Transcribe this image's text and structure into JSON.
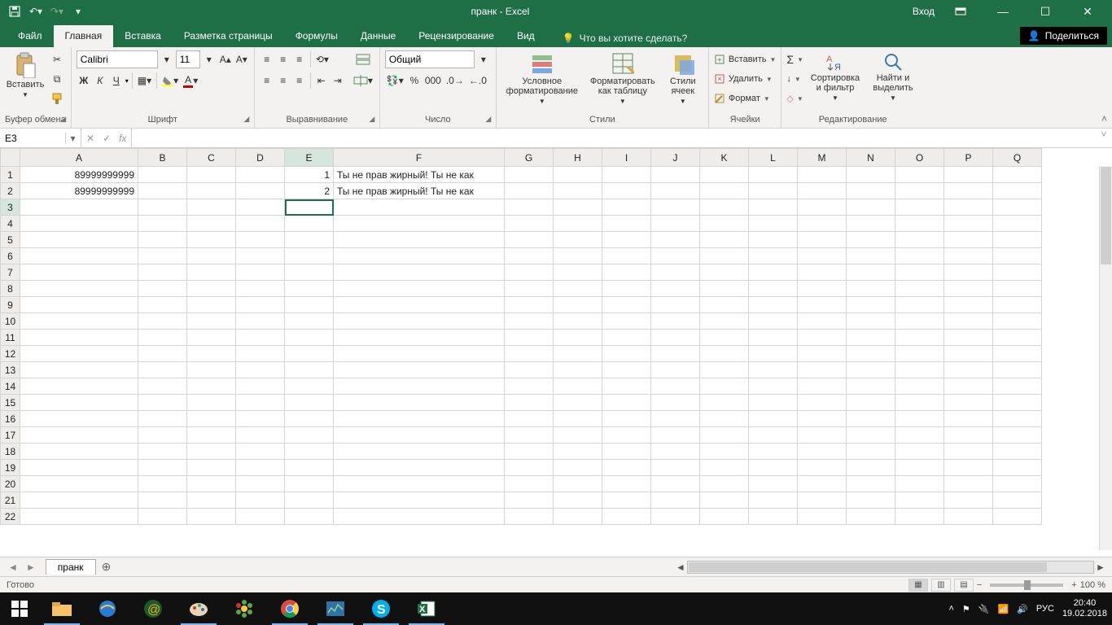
{
  "titlebar": {
    "title": "пранк  -  Excel",
    "login": "Вход"
  },
  "tabs": [
    "Файл",
    "Главная",
    "Вставка",
    "Разметка страницы",
    "Формулы",
    "Данные",
    "Рецензирование",
    "Вид"
  ],
  "active_tab_index": 1,
  "tellme": "Что вы хотите сделать?",
  "share": "Поделиться",
  "ribbon": {
    "clipboard": {
      "paste": "Вставить",
      "label": "Буфер обмена"
    },
    "font": {
      "name": "Calibri",
      "size": "11",
      "label": "Шрифт",
      "bold": "Ж",
      "italic": "К",
      "underline": "Ч"
    },
    "align": {
      "label": "Выравнивание"
    },
    "number": {
      "format": "Общий",
      "label": "Число"
    },
    "styles": {
      "cond": "Условное форматирование",
      "table": "Форматировать как таблицу",
      "cell": "Стили ячеек",
      "label": "Стили"
    },
    "cells": {
      "insert": "Вставить",
      "delete": "Удалить",
      "format": "Формат",
      "label": "Ячейки"
    },
    "editing": {
      "sort": "Сортировка и фильтр",
      "find": "Найти и выделить",
      "label": "Редактирование"
    }
  },
  "namebox": "E3",
  "formula": "",
  "columns": [
    "A",
    "B",
    "C",
    "D",
    "E",
    "F",
    "G",
    "H",
    "I",
    "J",
    "K",
    "L",
    "M",
    "N",
    "O",
    "P",
    "Q"
  ],
  "selected_col": "E",
  "selected_row": 3,
  "row_count": 22,
  "cells": {
    "r1": {
      "A": "89999999999",
      "E": "1",
      "F": "Ты не прав жирный! Ты не как"
    },
    "r2": {
      "A": "89999999999",
      "E": "2",
      "F": "Ты не прав жирный! Ты не как"
    }
  },
  "sheet_name": "пранк",
  "status": {
    "ready": "Готово",
    "zoom": "100 %"
  },
  "taskbar": {
    "lang": "РУС",
    "time": "20:40",
    "date": "19.02.2018"
  }
}
